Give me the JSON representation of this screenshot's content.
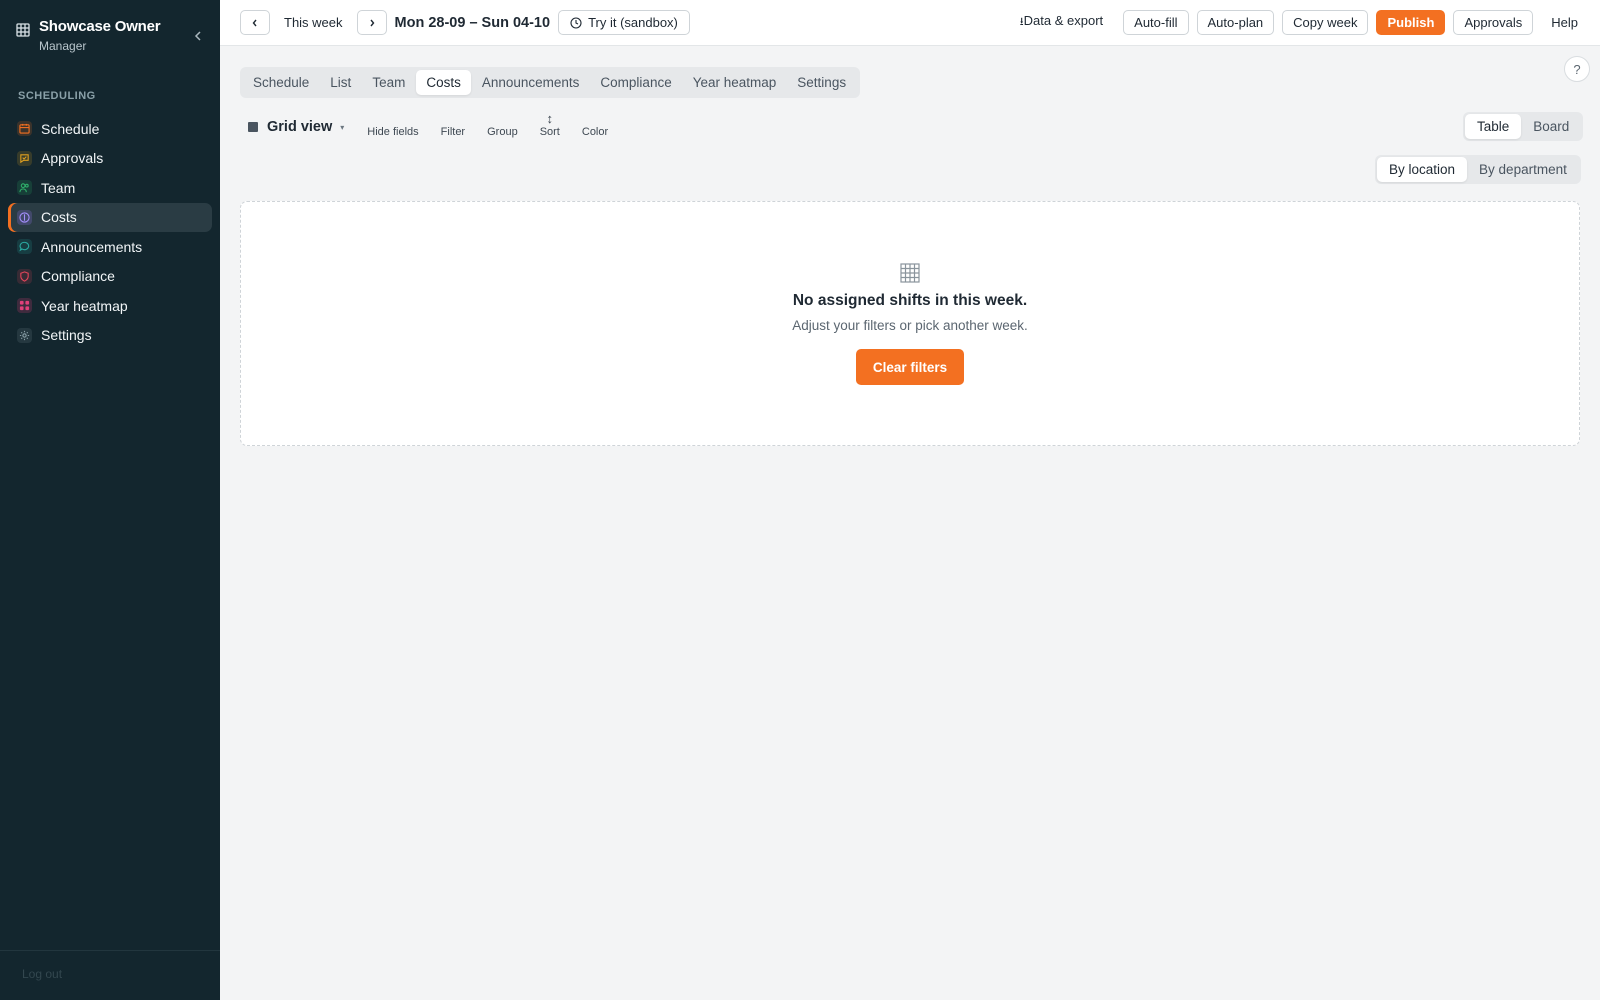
{
  "sidebar": {
    "owner_name": "Showcase Owner",
    "owner_role": "Manager",
    "section_label": "SCHEDULING",
    "items": [
      {
        "label": "Schedule",
        "icon": "calendar-icon",
        "color": "#f37021",
        "active": false
      },
      {
        "label": "Approvals",
        "icon": "chat-check-icon",
        "color": "#e0a020",
        "active": false
      },
      {
        "label": "Team",
        "icon": "users-icon",
        "color": "#2fb06a",
        "active": false
      },
      {
        "label": "Costs",
        "icon": "dollar-icon",
        "color": "#8a6fe0",
        "active": true
      },
      {
        "label": "Announcements",
        "icon": "message-icon",
        "color": "#2aa8a0",
        "active": false
      },
      {
        "label": "Compliance",
        "icon": "shield-icon",
        "color": "#e0455a",
        "active": false
      },
      {
        "label": "Year heatmap",
        "icon": "heatmap-icon",
        "color": "#e0407a",
        "active": false
      },
      {
        "label": "Settings",
        "icon": "gear-icon",
        "color": "#8aa0a8",
        "active": false
      }
    ],
    "footer_label": "Log out"
  },
  "topbar": {
    "this_week": "This week",
    "date_range": "Mon 28-09 – Sun 04-10",
    "sandbox": "Try it (sandbox)",
    "export": "Data & export",
    "autofill": "Auto-fill",
    "autoplan": "Auto-plan",
    "copy_week": "Copy week",
    "publish": "Publish",
    "approvals": "Approvals",
    "help": "Help"
  },
  "tabs": [
    {
      "label": "Schedule",
      "active": false
    },
    {
      "label": "List",
      "active": false
    },
    {
      "label": "Team",
      "active": false
    },
    {
      "label": "Costs",
      "active": true
    },
    {
      "label": "Announcements",
      "active": false
    },
    {
      "label": "Compliance",
      "active": false
    },
    {
      "label": "Year heatmap",
      "active": false
    },
    {
      "label": "Settings",
      "active": false
    }
  ],
  "help_circle": "?",
  "toolbar": {
    "grid_view": "Grid view",
    "hide_fields": "Hide fields",
    "filter": "Filter",
    "group": "Group",
    "sort": "Sort",
    "color": "Color"
  },
  "view_toggle": {
    "table": "Table",
    "board": "Board",
    "selected": "Table"
  },
  "group_toggle": {
    "by_location": "By location",
    "by_department": "By department",
    "selected": "By location"
  },
  "empty_state": {
    "title": "No assigned shifts in this week.",
    "subtitle": "Adjust your filters or pick another week.",
    "button": "Clear filters"
  },
  "colors": {
    "accent": "#f37021",
    "sidebar_bg": "#13262e"
  }
}
